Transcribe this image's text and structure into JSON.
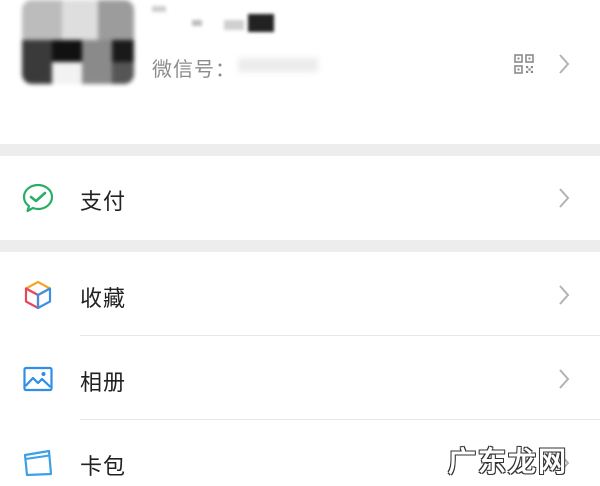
{
  "profile": {
    "wechat_id_label": "微信号：",
    "qr_icon": "qr-code-icon",
    "chevron_icon": "chevron-right-icon"
  },
  "menu": [
    {
      "label": "支付",
      "icon": "wechat-pay-icon"
    },
    {
      "label": "收藏",
      "icon": "favorites-cube-icon"
    },
    {
      "label": "相册",
      "icon": "album-picture-icon"
    },
    {
      "label": "卡包",
      "icon": "card-wallet-icon"
    }
  ],
  "watermark": "广东龙网",
  "colors": {
    "pay_green": "#2aae67",
    "album_blue": "#2f8ee8",
    "card_blue": "#3aa0e8",
    "separator": "#ededed",
    "secondary_text": "#8c8c8c"
  }
}
